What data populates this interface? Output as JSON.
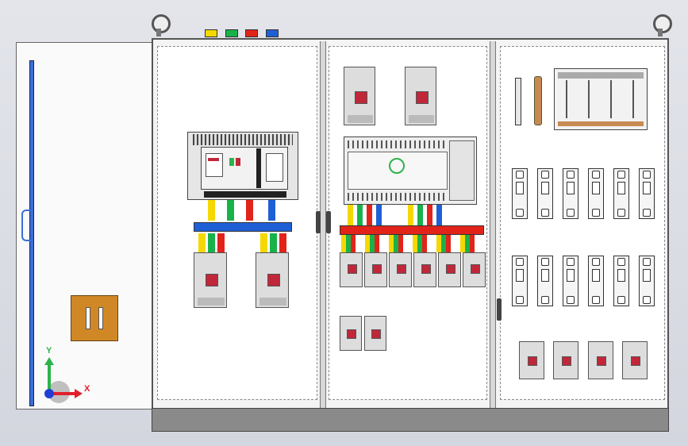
{
  "viewport": {
    "background_top": "#e3e5eb",
    "background_bottom": "#d3d6de"
  },
  "colors": {
    "phase_l1": "#f5d800",
    "phase_l2": "#19b24a",
    "phase_l3": "#e2231a",
    "neutral": "#1f5fd6",
    "pe_bar": "#3a6fd8",
    "busbar_copper": "#c88a50",
    "handle": "#d08826",
    "breaker_toggle": "#c0283a"
  },
  "tags": {
    "icons": [
      "tag-yellow-icon",
      "tag-green-icon",
      "tag-red-icon",
      "tag-blue-icon"
    ]
  },
  "triad": {
    "y_label": "Y",
    "x_label": "X",
    "y_color": "#2db34a",
    "x_color": "#e0202a",
    "z_color": "#1f3fd6"
  },
  "left_panel": {
    "incomer": "air-circuit-breaker",
    "outgoing_breakers": 2
  },
  "middle_panel": {
    "top_breakers": 2,
    "outgoing_breakers_row": 6,
    "spare_breakers": 2
  },
  "right_panel": {
    "mcb_row_1": 6,
    "mcb_row_2": 6,
    "bottom_breakers": 4
  }
}
